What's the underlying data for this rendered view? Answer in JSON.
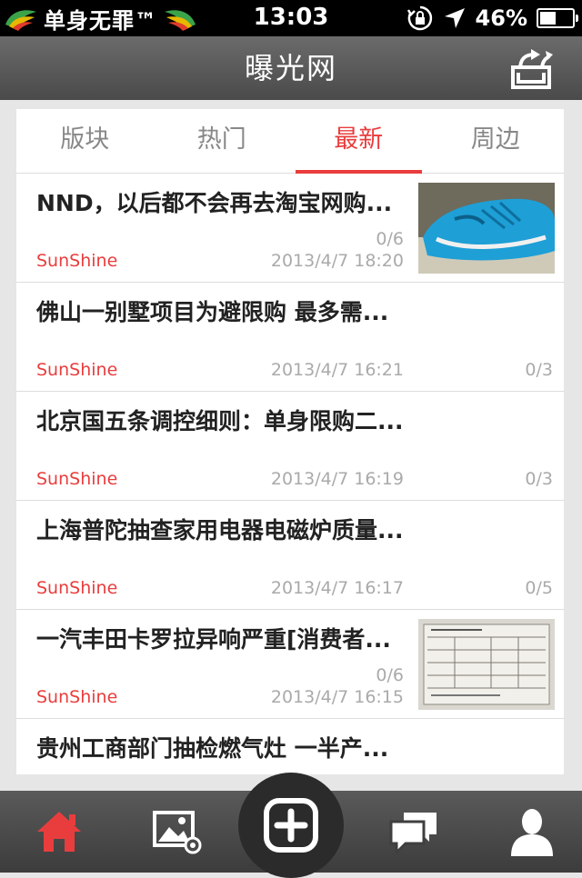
{
  "status_bar": {
    "carrier": "单身无罪™",
    "time": "13:03",
    "battery": "46%",
    "battery_level": 0.46
  },
  "nav": {
    "title": "曝光网",
    "share_icon": "share-export-icon"
  },
  "tabs": [
    {
      "label": "版块",
      "active": false
    },
    {
      "label": "热门",
      "active": false
    },
    {
      "label": "最新",
      "active": true
    },
    {
      "label": "周边",
      "active": false
    }
  ],
  "posts": [
    {
      "title": "NND，以后都不会再去淘宝网购...",
      "author": "SunShine",
      "date": "2013/4/7 18:20",
      "count": "0/6",
      "thumbnail": "blue-sneaker-photo"
    },
    {
      "title": "佛山一别墅项目为避限购 最多需...",
      "author": "SunShine",
      "date": "2013/4/7 16:21",
      "count": "0/3",
      "thumbnail": ""
    },
    {
      "title": "北京国五条调控细则：单身限购二...",
      "author": "SunShine",
      "date": "2013/4/7 16:19",
      "count": "0/3",
      "thumbnail": ""
    },
    {
      "title": "上海普陀抽查家用电器电磁炉质量...",
      "author": "SunShine",
      "date": "2013/4/7 16:17",
      "count": "0/5",
      "thumbnail": ""
    },
    {
      "title": "一汽丰田卡罗拉异响严重[消费者...",
      "author": "SunShine",
      "date": "2013/4/7 16:15",
      "count": "0/6",
      "thumbnail": "document-form-photo"
    },
    {
      "title": "贵州工商部门抽检燃气灶 一半产...",
      "author": "",
      "date": "",
      "count": "",
      "thumbnail": ""
    }
  ],
  "tabbar": {
    "items": [
      "home-icon",
      "photo-gallery-icon",
      "add-icon",
      "chat-icon",
      "user-icon"
    ],
    "active_color": "#e93d3d"
  },
  "colors": {
    "accent": "#e93d3d",
    "navbar": "#555555",
    "muted": "#aaaaaa"
  }
}
